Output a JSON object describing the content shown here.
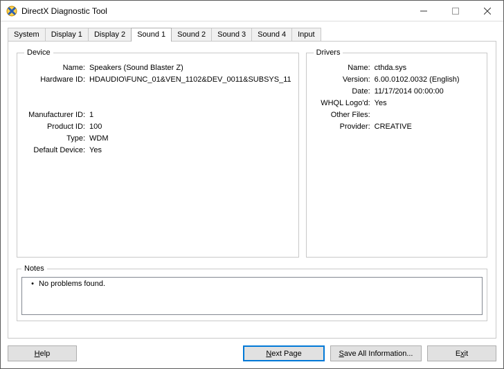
{
  "window": {
    "title": "DirectX Diagnostic Tool"
  },
  "tabs": [
    {
      "label": "System"
    },
    {
      "label": "Display 1"
    },
    {
      "label": "Display 2"
    },
    {
      "label": "Sound 1",
      "active": true
    },
    {
      "label": "Sound 2"
    },
    {
      "label": "Sound 3"
    },
    {
      "label": "Sound 4"
    },
    {
      "label": "Input"
    }
  ],
  "groups": {
    "device": "Device",
    "drivers": "Drivers",
    "notes": "Notes"
  },
  "device": {
    "labels": {
      "name": "Name:",
      "hardware_id": "Hardware ID:",
      "manufacturer_id": "Manufacturer ID:",
      "product_id": "Product ID:",
      "type": "Type:",
      "default_device": "Default Device:"
    },
    "name": "Speakers (Sound Blaster Z)",
    "hardware_id": "HDAUDIO\\FUNC_01&VEN_1102&DEV_0011&SUBSYS_11",
    "manufacturer_id": "1",
    "product_id": "100",
    "type": "WDM",
    "default_device": "Yes"
  },
  "drivers": {
    "labels": {
      "name": "Name:",
      "version": "Version:",
      "date": "Date:",
      "whql": "WHQL Logo'd:",
      "other_files": "Other Files:",
      "provider": "Provider:"
    },
    "name": "cthda.sys",
    "version": "6.00.0102.0032 (English)",
    "date": "11/17/2014 00:00:00",
    "whql": "Yes",
    "other_files": "",
    "provider": "CREATIVE"
  },
  "notes": {
    "items": [
      "No problems found."
    ]
  },
  "buttons": {
    "help_u": "H",
    "help_rest": "elp",
    "next_u": "N",
    "next_rest": "ext Page",
    "save_u": "S",
    "save_rest": "ave All Information...",
    "exit_pre": "E",
    "exit_u": "x",
    "exit_rest": "it"
  }
}
